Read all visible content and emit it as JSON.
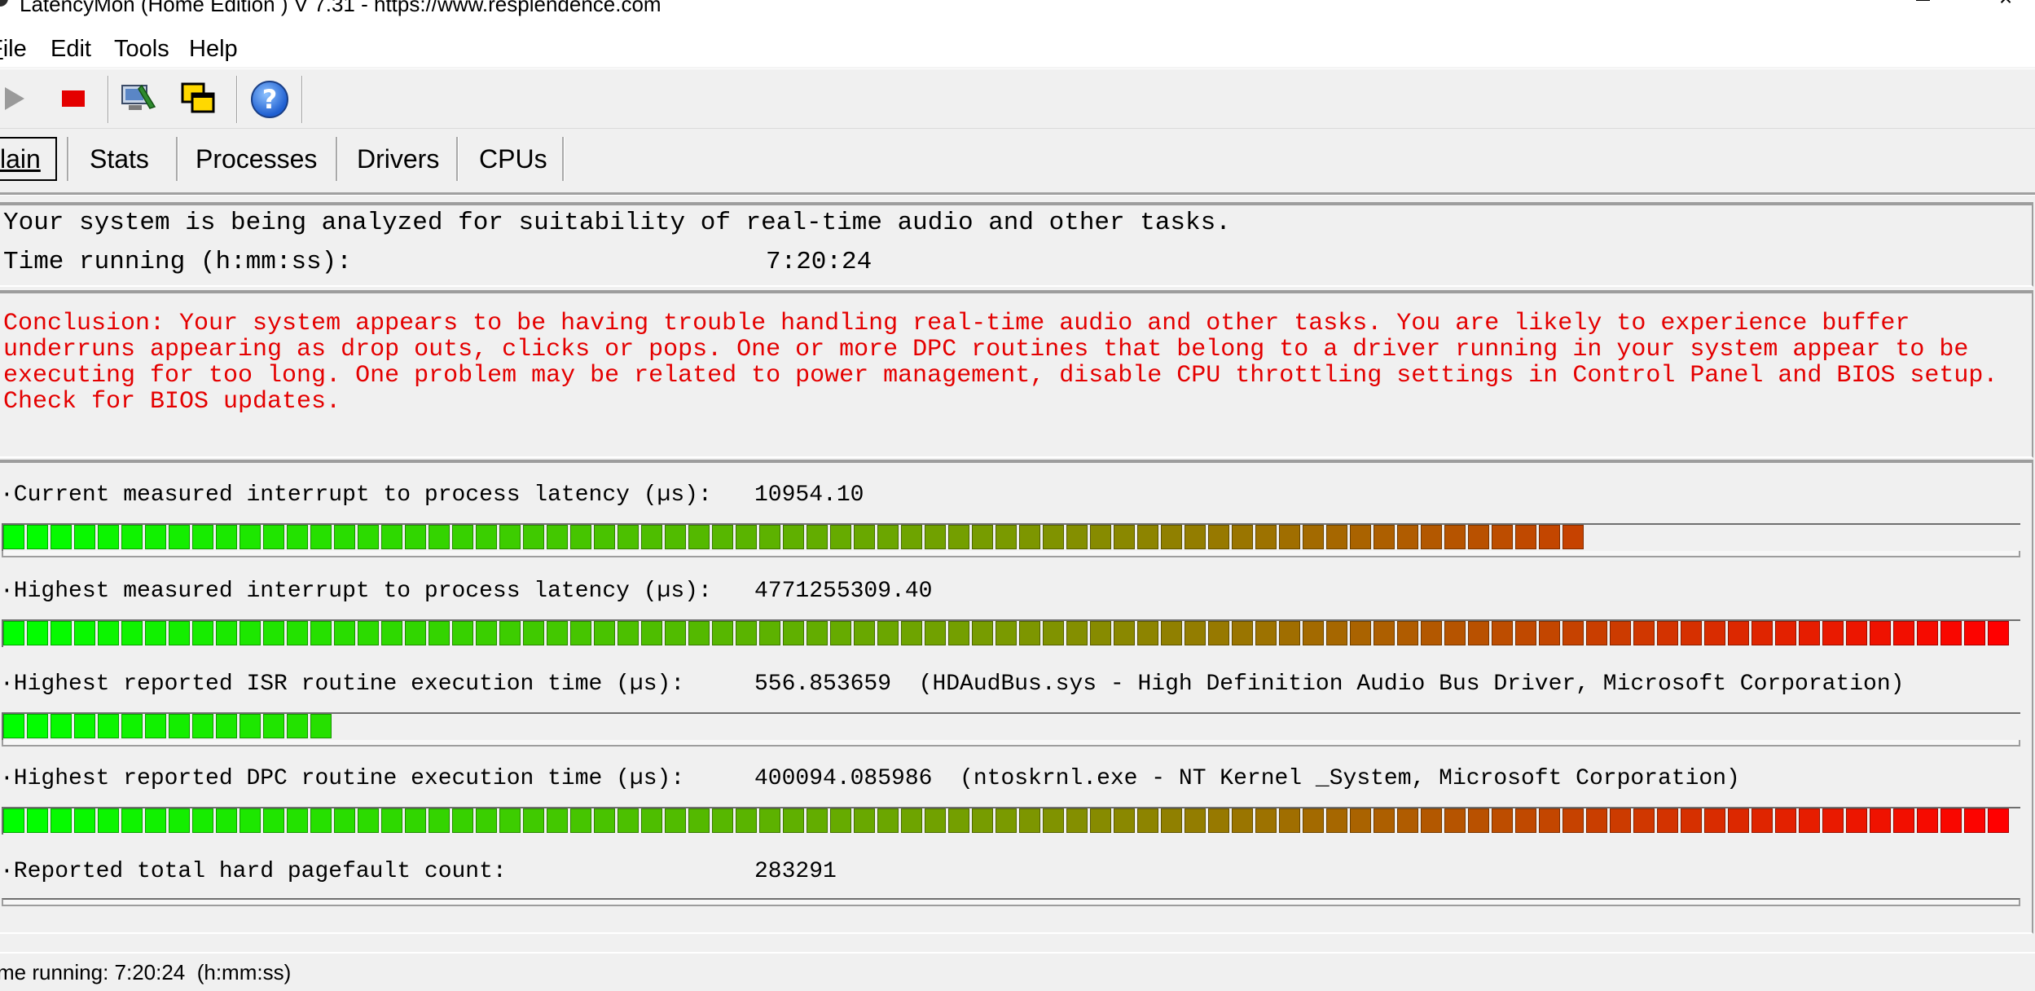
{
  "window": {
    "title": "LatencyMon  (Home Edition )  V 7.31 - https://www.resplendence.com",
    "maximize_icon": "maximize-icon",
    "close_label": "×"
  },
  "menu": {
    "items": [
      {
        "label": "ile",
        "key": "F"
      },
      {
        "label": "Edit",
        "key": "E"
      },
      {
        "label": "Tools",
        "key": "T"
      },
      {
        "label": "Help",
        "key": "H"
      }
    ]
  },
  "toolbar": {
    "buttons": [
      "play-icon",
      "stop-icon",
      "monitor-icon",
      "windows-icon",
      "help-icon"
    ],
    "help_glyph": "?"
  },
  "tabs": [
    {
      "label": "lain",
      "active": true
    },
    {
      "label": "Stats",
      "active": false
    },
    {
      "label": "Processes",
      "active": false
    },
    {
      "label": "Drivers",
      "active": false
    },
    {
      "label": "CPUs",
      "active": false
    }
  ],
  "status": {
    "analyzing_text": "Your system is being analyzed for suitability of real-time audio and other tasks.",
    "time_running_label": "Time running (h:mm:ss):",
    "time_running_value": "7:20:24"
  },
  "conclusion": {
    "lines": [
      "Conclusion: Your system appears to be having trouble handling real-time audio and other tasks. You are likely to experience buffer",
      "underruns appearing as drop outs, clicks or pops. One or more DPC routines that belong to a driver running in your system appear to be",
      "executing for too long. One problem may be related to power management, disable CPU throttling settings in Control Panel and BIOS setup.",
      "Check for BIOS updates."
    ],
    "color": "#e40000"
  },
  "metrics": [
    {
      "label": "·Current measured interrupt to process latency (µs):",
      "value": "10954.10",
      "detail": "",
      "bar_fraction": 0.79,
      "has_bar": true
    },
    {
      "label": "·Highest measured interrupt to process latency (µs):",
      "value": "4771255309.40",
      "detail": "",
      "bar_fraction": 1.0,
      "has_bar": true
    },
    {
      "label": "·Highest reported ISR routine execution time (µs):",
      "value": "556.853659",
      "detail": "  (HDAudBus.sys - High Definition Audio Bus Driver, Microsoft Corporation)",
      "bar_fraction": 0.163,
      "has_bar": true
    },
    {
      "label": "·Highest reported DPC routine execution time (µs):",
      "value": "400094.085986",
      "detail": "  (ntoskrnl.exe - NT Kernel _System, Microsoft Corporation)",
      "bar_fraction": 1.0,
      "has_bar": true
    },
    {
      "label": "·Reported total hard pagefault count:",
      "value": "283291",
      "detail": "",
      "bar_fraction": 0,
      "has_bar": false
    }
  ],
  "bar_colors": {
    "start": "#00ff00",
    "mid": "#7a9a00",
    "end": "#ff0000"
  },
  "statusbar": {
    "text": "me running: 7:20:24  (h:mm:ss)"
  }
}
